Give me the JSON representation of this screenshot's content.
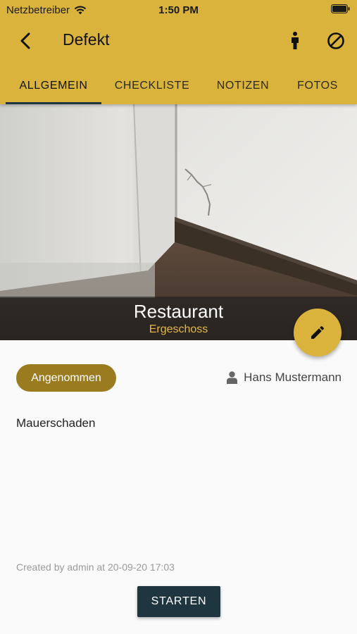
{
  "status_bar": {
    "carrier": "Netzbetreiber",
    "time": "1:50 PM",
    "wifi_icon": "wifi-icon",
    "battery_icon": "battery-icon"
  },
  "app_bar": {
    "title": "Defekt",
    "back_icon": "back-arrow-icon",
    "person_icon": "person-standing-icon",
    "block_icon": "block-icon",
    "background": "#d9b33b"
  },
  "tabs": [
    {
      "label": "ALLGEMEIN",
      "active": true
    },
    {
      "label": "CHECKLISTE",
      "active": false
    },
    {
      "label": "NOTIZEN",
      "active": false
    },
    {
      "label": "FOTOS",
      "active": false
    }
  ],
  "photo": {
    "location_name": "Restaurant",
    "location_floor": "Ergeschoss"
  },
  "fab": {
    "icon": "edit-pencil-icon"
  },
  "defect": {
    "status": "Angenommen",
    "assignee": "Hans Mustermann",
    "description": "Mauerschaden",
    "created": "Created by admin at 20-09-20 17:03"
  },
  "actions": {
    "start_label": "STARTEN"
  },
  "colors": {
    "primary": "#d9b33b",
    "status_chip": "#9b7b1f",
    "button": "#1f3540",
    "floor_text": "#e2b843"
  }
}
